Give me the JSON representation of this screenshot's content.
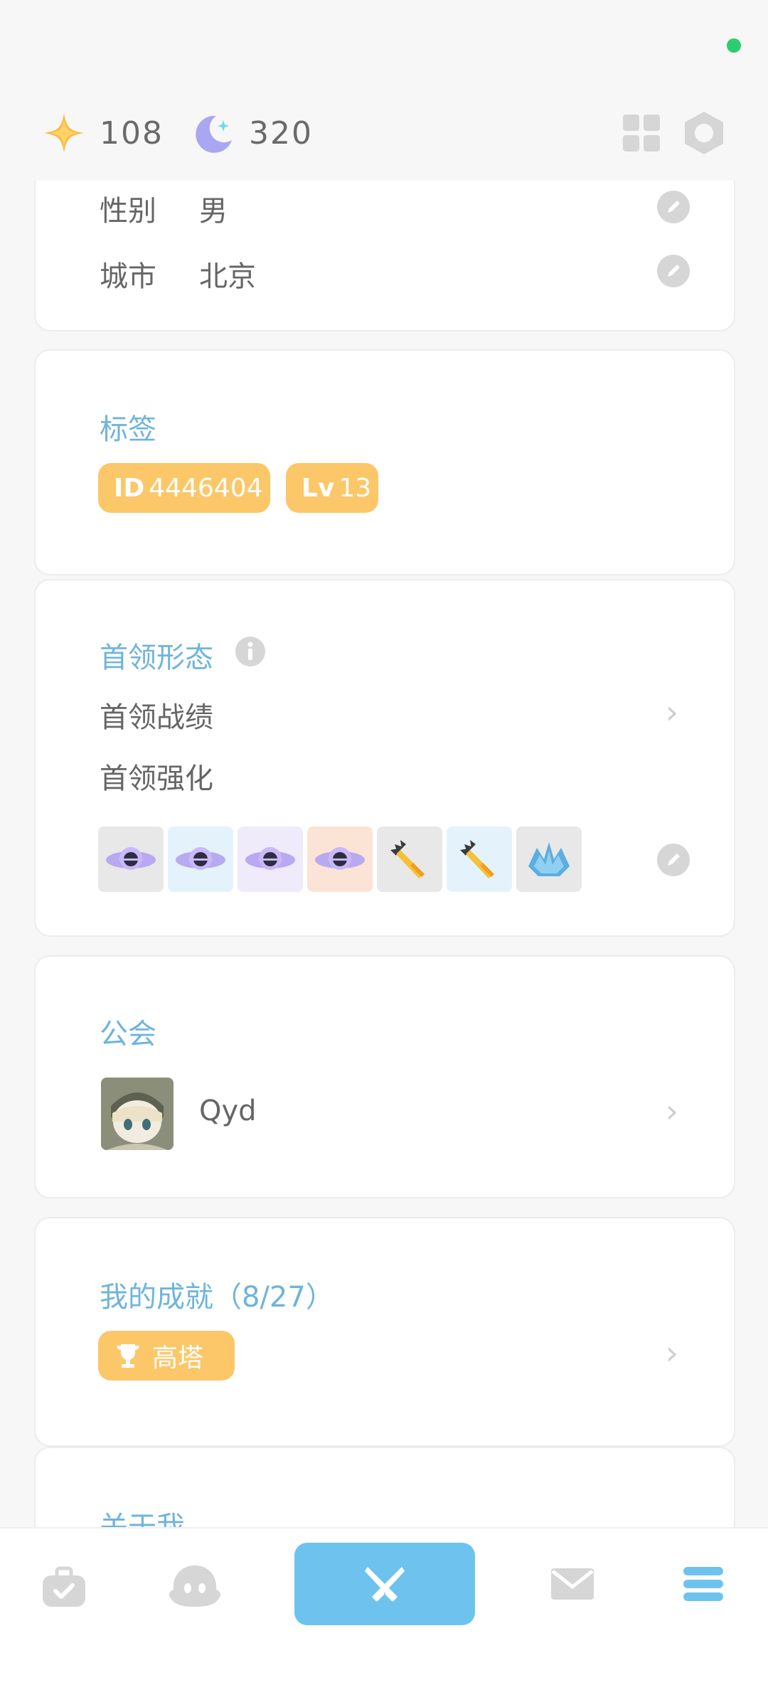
{
  "topbar": {
    "star_value": "108",
    "moon_value": "320",
    "icons": [
      "star-currency-icon",
      "moon-currency-icon",
      "grid-icon",
      "hexagon-icon"
    ]
  },
  "profile_info": {
    "gender_label": "性别",
    "gender_value": "男",
    "city_label": "城市",
    "city_value": "北京"
  },
  "tags": {
    "title": "标签",
    "id_prefix": "ID",
    "id_value": "4446404",
    "lv_prefix": "Lv",
    "lv_value": "13"
  },
  "boss": {
    "title": "首领形态",
    "record_label": "首领战绩",
    "enhance_label": "首领强化",
    "items": [
      {
        "name": "black-hole-boss-icon",
        "bg": "#e8e8e8"
      },
      {
        "name": "black-hole-boss-icon",
        "bg": "#e4f3fb"
      },
      {
        "name": "black-hole-boss-icon",
        "bg": "#efebfb"
      },
      {
        "name": "black-hole-boss-icon",
        "bg": "#fbe3d6"
      },
      {
        "name": "rocket-boss-icon",
        "bg": "#e8e8e8"
      },
      {
        "name": "rocket-boss-icon",
        "bg": "#e4f3fb"
      },
      {
        "name": "ice-crystal-boss-icon",
        "bg": "#e8e8e8"
      }
    ]
  },
  "guild": {
    "title": "公会",
    "name": "Qyd"
  },
  "achievements": {
    "title": "我的成就（8/27）",
    "badge_label": "高塔"
  },
  "about": {
    "title": "关于我"
  },
  "nav": {
    "items": [
      "bag-icon",
      "character-icon",
      "battle-icon",
      "mail-icon",
      "menu-icon"
    ],
    "active_color": "#6ec3ee",
    "accent_tag_color": "#fcc769",
    "title_color": "#6fb4dc"
  }
}
